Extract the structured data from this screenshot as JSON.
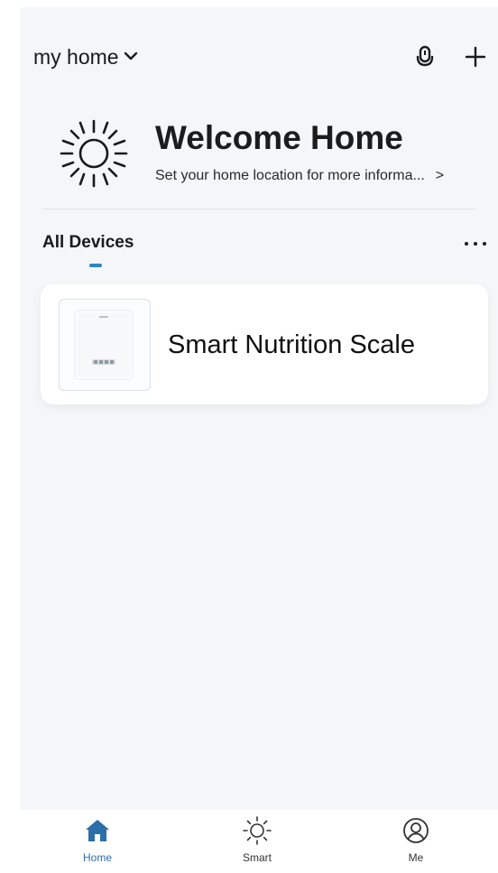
{
  "header": {
    "home_name": "my home",
    "home_dropdown_icon": "chevron-down-icon",
    "voice_icon": "microphone-icon",
    "add_icon": "plus-icon"
  },
  "welcome": {
    "icon": "sun-icon",
    "title": "Welcome Home",
    "subtitle": "Set your home location for more informa...",
    "arrow": ">"
  },
  "devices_section": {
    "tab_label": "All Devices",
    "more_icon": "more-dots-icon",
    "active_color": "#2e86c1"
  },
  "devices": [
    {
      "name": "Smart Nutrition Scale",
      "icon": "scale-device-image"
    }
  ],
  "bottom_nav": {
    "items": [
      {
        "label": "Home",
        "icon": "home-icon",
        "active": true
      },
      {
        "label": "Smart",
        "icon": "sun-icon",
        "active": false
      },
      {
        "label": "Me",
        "icon": "user-icon",
        "active": false
      }
    ],
    "active_color": "#2a6fa8"
  }
}
